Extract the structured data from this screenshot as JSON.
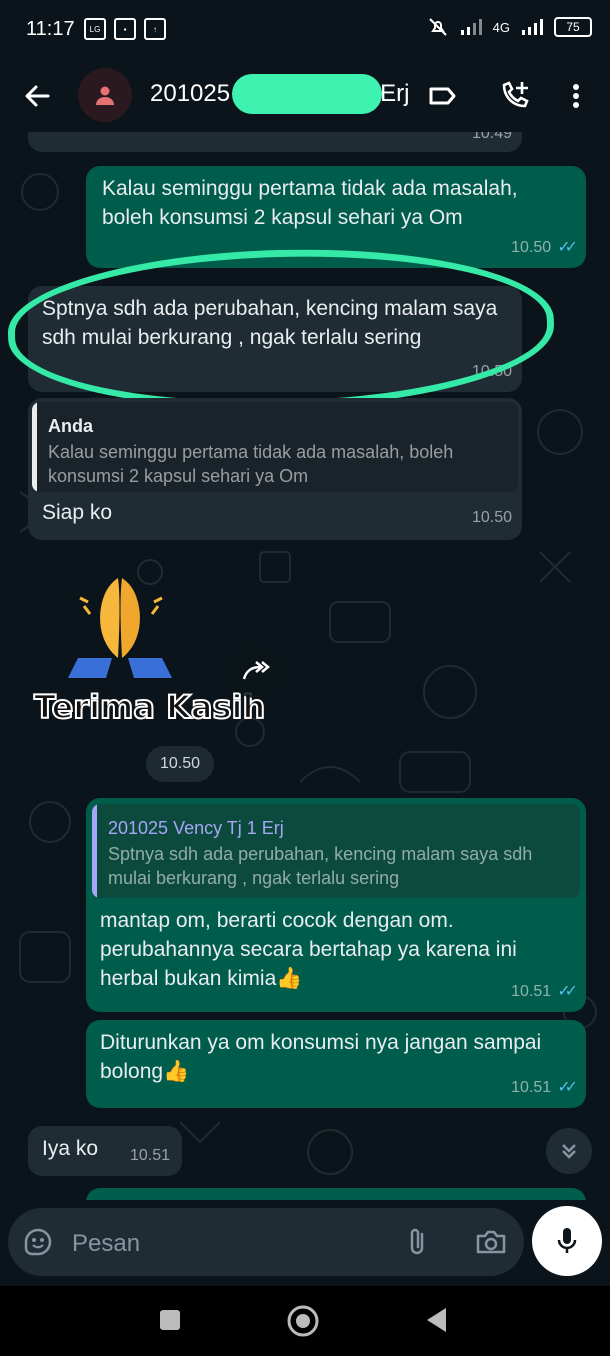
{
  "status_bar": {
    "time": "11:17",
    "battery": "75",
    "network": "4G"
  },
  "header": {
    "title": "201025",
    "title_tail": "Erj"
  },
  "messages": [
    {
      "text": "Kalau seminggu pertama tidak ada masalah, boleh konsumsi 2 kapsul sehari ya Om",
      "time": "10.50"
    },
    {
      "text": "Sptnya sdh ada perubahan, kencing malam saya sdh mulai berkurang , ngak terlalu sering",
      "time": "10.50"
    },
    {
      "quote_name": "Anda",
      "quote_text": "Kalau seminggu pertama tidak ada masalah, boleh konsumsi 2 kapsul sehari ya Om",
      "text": "Siap ko",
      "time": "10.50"
    },
    {
      "sticker_text": "Terima Kasih",
      "time": "10.50"
    },
    {
      "quote_name": "201025 Vency Tj 1 Erj",
      "quote_text": "Sptnya sdh ada perubahan, kencing malam saya sdh mulai berkurang , ngak terlalu sering",
      "text": "mantap om, berarti cocok dengan om. perubahannya secara bertahap ya karena ini herbal bukan kimia👍",
      "time": "10.51"
    },
    {
      "text": "Diturunkan ya om konsumsi nya jangan sampai bolong👍",
      "time": "10.51"
    },
    {
      "text": "Iya ko",
      "time": "10.51"
    },
    {
      "time": "10.49"
    }
  ],
  "input": {
    "placeholder": "Pesan"
  },
  "colors": {
    "incoming": "#1f2c34",
    "outgoing": "#005c4b",
    "highlight": "#35e9a6",
    "ticks": "#53bdeb"
  }
}
